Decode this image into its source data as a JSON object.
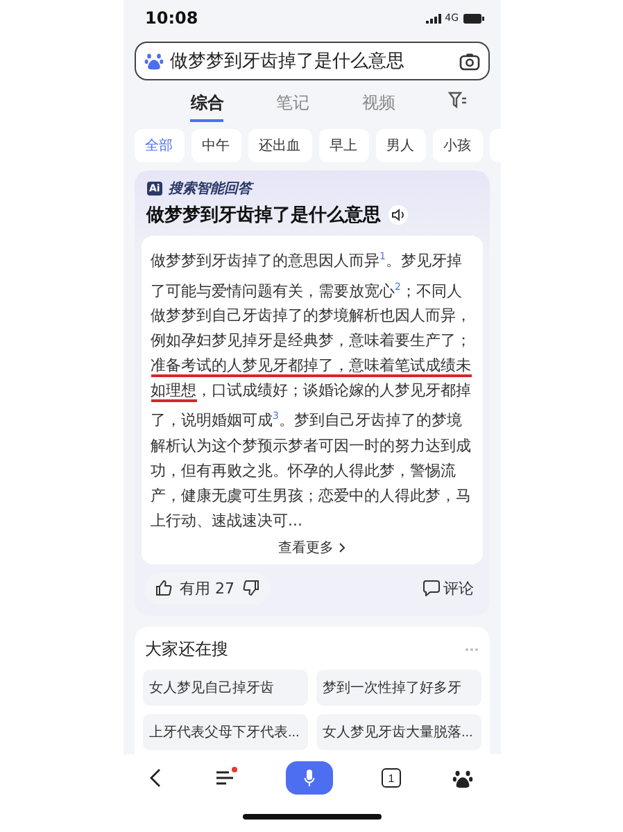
{
  "status_bar": {
    "time": "10:08",
    "network": "4G"
  },
  "search": {
    "value": "做梦梦到牙齿掉了是什么意思"
  },
  "tabs": [
    {
      "label": "综合",
      "selected": true
    },
    {
      "label": "笔记",
      "selected": false
    },
    {
      "label": "视频",
      "selected": false
    }
  ],
  "chips": [
    {
      "label": "全部",
      "selected": true
    },
    {
      "label": "中午",
      "selected": false
    },
    {
      "label": "还出血",
      "selected": false
    },
    {
      "label": "早上",
      "selected": false
    },
    {
      "label": "男人",
      "selected": false
    },
    {
      "label": "小孩",
      "selected": false
    }
  ],
  "ai_answer": {
    "badge": "Ai",
    "source": "搜索智能回答",
    "title": "做梦梦到牙齿掉了是什么意思",
    "segments": [
      {
        "kind": "plain",
        "text": "做梦梦到牙齿掉了的意思因人而异"
      },
      {
        "kind": "ref",
        "text": "1"
      },
      {
        "kind": "plain",
        "text": "。梦见牙掉了可能与爱情问题有关，需要放宽心"
      },
      {
        "kind": "ref",
        "text": "2"
      },
      {
        "kind": "plain",
        "text": "；不同人做梦梦到自己牙齿掉了的梦境解析也因人而异，例如孕妇梦见掉牙是经典梦，意味着要生产了；"
      },
      {
        "kind": "marked",
        "text": "准备考试的人梦见牙都掉了，意味着笔试成绩未如理想"
      },
      {
        "kind": "plain",
        "text": "，口试成绩好；谈婚论嫁的人梦见牙都掉了，说明婚姻可成"
      },
      {
        "kind": "ref",
        "text": "3"
      },
      {
        "kind": "plain",
        "text": "。梦到自己牙齿掉了的梦境解析认为这个梦预示梦者可因一时的努力达到成功，但有再败之兆。怀孕的人得此梦，警惕流产，健康无虞可生男孩；恋爱中的人得此梦，马上行动、速战速决可..."
      }
    ],
    "more": "查看更多",
    "useful": "有用 27",
    "comment": "评论"
  },
  "related": {
    "title": "大家还在搜",
    "items": [
      "女人梦见自己掉牙齿",
      "梦到一次性掉了好多牙",
      "上牙代表父母下牙代表...",
      "女人梦见牙齿大量脱落..."
    ]
  },
  "bottom_nav": {
    "tab_count": "1",
    "menu_badge": true
  }
}
